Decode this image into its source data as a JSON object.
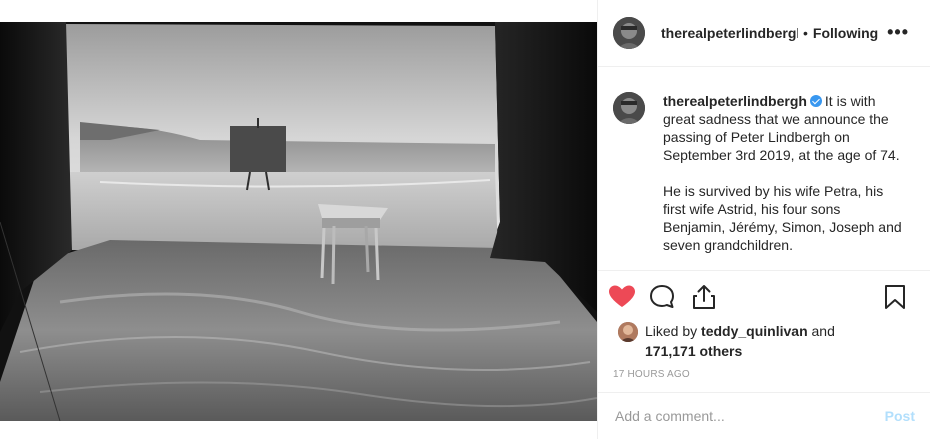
{
  "header": {
    "username": "therealpeterlindbergh",
    "separator": "•",
    "follow_status": "Following",
    "more_label": "•••"
  },
  "caption": {
    "username": "therealpeterlindbergh",
    "paragraph1": "It is with great sadness that we announce the passing of Peter Lindbergh on September 3rd 2019, at the age of 74.",
    "paragraph2": "He is survived by his wife Petra, his first wife Astrid, his four sons Benjamin, Jérémy, Simon, Joseph and seven grandchildren."
  },
  "actions": {
    "like_icon": "heart-filled-icon",
    "comment_icon": "comment-bubble-icon",
    "share_icon": "share-icon",
    "save_icon": "bookmark-icon",
    "like_color": "#ed4956"
  },
  "likes": {
    "prefix": "Liked by",
    "user": "teddy_quinlivan",
    "conjunction": "and",
    "others": "171,171 others"
  },
  "timestamp": "17 HOURS AGO",
  "comment": {
    "placeholder": "Add a comment...",
    "post_label": "Post",
    "post_color": "#b2dffc"
  }
}
